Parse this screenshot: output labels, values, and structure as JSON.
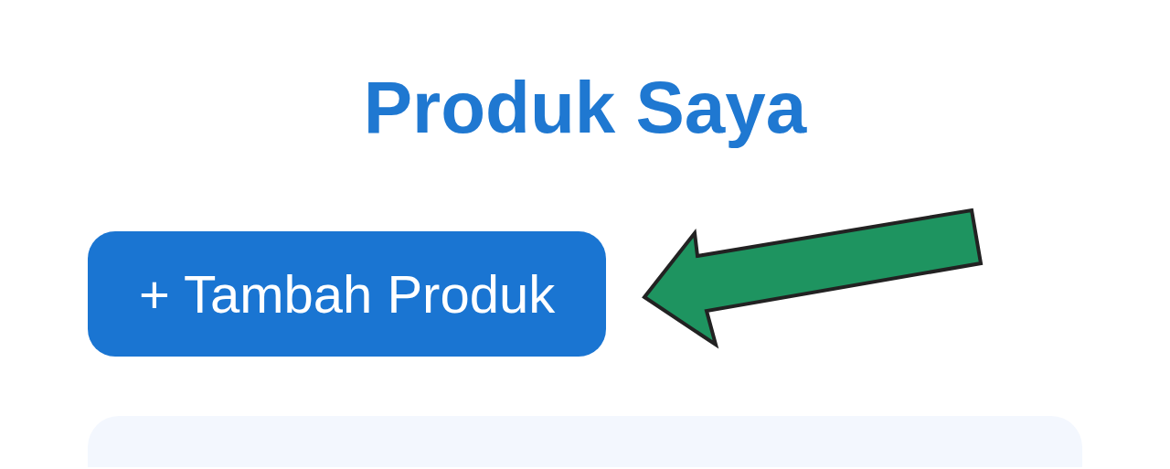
{
  "title": "Produk Saya",
  "add_button": {
    "label": "+ Tambah Produk"
  }
}
